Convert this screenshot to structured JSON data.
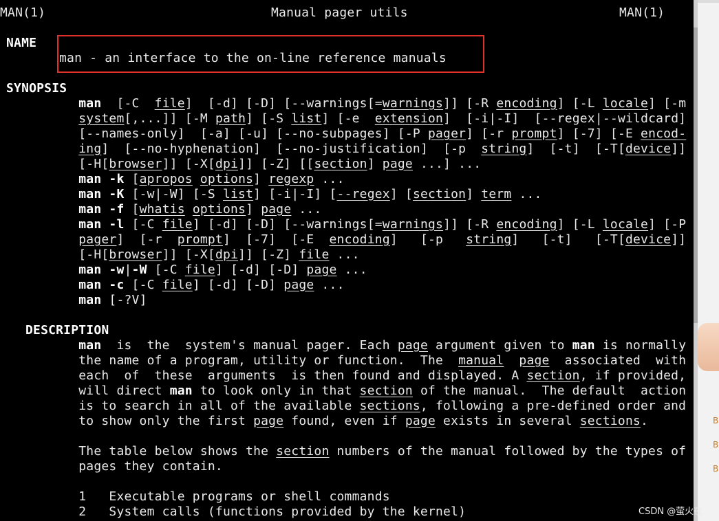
{
  "header": {
    "left": "MAN(1)",
    "center": "Manual pager utils",
    "right": "MAN(1)"
  },
  "name_section": {
    "heading": "NAME",
    "text": "man - an interface to the on-line reference manuals"
  },
  "synopsis_heading": "SYNOPSIS",
  "description_heading": "DESCRIPTION",
  "lines": [
    [
      {
        "t": "       "
      },
      {
        "t": "man",
        "b": 1
      },
      {
        "t": "  [-C  "
      },
      {
        "t": "file",
        "u": 1
      },
      {
        "t": "]  [-d] [-D] [--warnings[="
      },
      {
        "t": "warnings",
        "u": 1
      },
      {
        "t": "]] [-R "
      },
      {
        "t": "encoding",
        "u": 1
      },
      {
        "t": "] [-L "
      },
      {
        "t": "locale",
        "u": 1
      },
      {
        "t": "] [-m"
      }
    ],
    [
      {
        "t": "       "
      },
      {
        "t": "system",
        "u": 1
      },
      {
        "t": "[,...]] [-M "
      },
      {
        "t": "path",
        "u": 1
      },
      {
        "t": "] [-S "
      },
      {
        "t": "list",
        "u": 1
      },
      {
        "t": "] [-e  "
      },
      {
        "t": "extension",
        "u": 1
      },
      {
        "t": "]  [-i|-I]  [--regex|--wildcard]"
      }
    ],
    [
      {
        "t": "       [--names-only]  [-a] [-u] [--no-subpages] [-P "
      },
      {
        "t": "pager",
        "u": 1
      },
      {
        "t": "] [-r "
      },
      {
        "t": "prompt",
        "u": 1
      },
      {
        "t": "] [-7] [-E "
      },
      {
        "t": "encod-",
        "u": 1
      }
    ],
    [
      {
        "t": "       "
      },
      {
        "t": "ing",
        "u": 1
      },
      {
        "t": "]  [--no-hyphenation]  [--no-justification]  [-p  "
      },
      {
        "t": "string",
        "u": 1
      },
      {
        "t": "]  [-t]  [-T["
      },
      {
        "t": "device",
        "u": 1
      },
      {
        "t": "]]"
      }
    ],
    [
      {
        "t": "       [-H["
      },
      {
        "t": "browser",
        "u": 1
      },
      {
        "t": "]] [-X["
      },
      {
        "t": "dpi",
        "u": 1
      },
      {
        "t": "]] [-Z] [["
      },
      {
        "t": "section",
        "u": 1
      },
      {
        "t": "] "
      },
      {
        "t": "page",
        "u": 1
      },
      {
        "t": " ...] ..."
      }
    ],
    [
      {
        "t": "       "
      },
      {
        "t": "man -k",
        "b": 1
      },
      {
        "t": " ["
      },
      {
        "t": "apropos",
        "u": 1
      },
      {
        "t": " "
      },
      {
        "t": "options",
        "u": 1
      },
      {
        "t": "] "
      },
      {
        "t": "regexp",
        "u": 1
      },
      {
        "t": " ..."
      }
    ],
    [
      {
        "t": "       "
      },
      {
        "t": "man -K",
        "b": 1
      },
      {
        "t": " [-w|-W] [-S "
      },
      {
        "t": "list",
        "u": 1
      },
      {
        "t": "] [-i|-I] ["
      },
      {
        "t": "--regex",
        "u": 1
      },
      {
        "t": "] ["
      },
      {
        "t": "section",
        "u": 1
      },
      {
        "t": "] "
      },
      {
        "t": "term",
        "u": 1
      },
      {
        "t": " ..."
      }
    ],
    [
      {
        "t": "       "
      },
      {
        "t": "man -f",
        "b": 1
      },
      {
        "t": " ["
      },
      {
        "t": "whatis",
        "u": 1
      },
      {
        "t": " "
      },
      {
        "t": "options",
        "u": 1
      },
      {
        "t": "] "
      },
      {
        "t": "page",
        "u": 1
      },
      {
        "t": " ..."
      }
    ],
    [
      {
        "t": "       "
      },
      {
        "t": "man -l",
        "b": 1
      },
      {
        "t": " [-C "
      },
      {
        "t": "file",
        "u": 1
      },
      {
        "t": "] [-d] [-D] [--warnings[="
      },
      {
        "t": "warnings",
        "u": 1
      },
      {
        "t": "]] [-R "
      },
      {
        "t": "encoding",
        "u": 1
      },
      {
        "t": "] [-L "
      },
      {
        "t": "locale",
        "u": 1
      },
      {
        "t": "] [-P"
      }
    ],
    [
      {
        "t": "       "
      },
      {
        "t": "pager",
        "u": 1
      },
      {
        "t": "]  [-r  "
      },
      {
        "t": "prompt",
        "u": 1
      },
      {
        "t": "]  [-7]  [-E  "
      },
      {
        "t": "encoding",
        "u": 1
      },
      {
        "t": "]   [-p   "
      },
      {
        "t": "string",
        "u": 1
      },
      {
        "t": "]   [-t]   [-T["
      },
      {
        "t": "device",
        "u": 1
      },
      {
        "t": "]]"
      }
    ],
    [
      {
        "t": "       [-H["
      },
      {
        "t": "browser",
        "u": 1
      },
      {
        "t": "]] [-X["
      },
      {
        "t": "dpi",
        "u": 1
      },
      {
        "t": "]] [-Z] "
      },
      {
        "t": "file",
        "u": 1
      },
      {
        "t": " ..."
      }
    ],
    [
      {
        "t": "       "
      },
      {
        "t": "man -w",
        "b": 1
      },
      {
        "t": "|"
      },
      {
        "t": "-W",
        "b": 1
      },
      {
        "t": " [-C "
      },
      {
        "t": "file",
        "u": 1
      },
      {
        "t": "] [-d] [-D] "
      },
      {
        "t": "page",
        "u": 1
      },
      {
        "t": " ..."
      }
    ],
    [
      {
        "t": "       "
      },
      {
        "t": "man -c",
        "b": 1
      },
      {
        "t": " [-C "
      },
      {
        "t": "file",
        "u": 1
      },
      {
        "t": "] [-d] [-D] "
      },
      {
        "t": "page",
        "u": 1
      },
      {
        "t": " ..."
      }
    ],
    [
      {
        "t": "       "
      },
      {
        "t": "man",
        "b": 1
      },
      {
        "t": " [-?V]"
      }
    ],
    [],
    [
      {
        "t": "DESCRIPTION",
        "b": 1
      }
    ],
    [
      {
        "t": "       "
      },
      {
        "t": "man",
        "b": 1
      },
      {
        "t": "  is  the  system's manual pager. Each "
      },
      {
        "t": "page",
        "u": 1
      },
      {
        "t": " argument given to "
      },
      {
        "t": "man",
        "b": 1
      },
      {
        "t": " is normally"
      }
    ],
    [
      {
        "t": "       the name of a program, utility or function.  The  "
      },
      {
        "t": "manual",
        "u": 1
      },
      {
        "t": "  "
      },
      {
        "t": "page",
        "u": 1
      },
      {
        "t": "  associated  with"
      }
    ],
    [
      {
        "t": "       each  of  these  arguments  is then found and displayed. A "
      },
      {
        "t": "section",
        "u": 1
      },
      {
        "t": ", if provided,"
      }
    ],
    [
      {
        "t": "       will direct "
      },
      {
        "t": "man",
        "b": 1
      },
      {
        "t": " to look only in that "
      },
      {
        "t": "section",
        "u": 1
      },
      {
        "t": " of the manual.  The default  action"
      }
    ],
    [
      {
        "t": "       is to search in all of the available "
      },
      {
        "t": "sections",
        "u": 1
      },
      {
        "t": ", following a pre-defined order and"
      }
    ],
    [
      {
        "t": "       to show only the first "
      },
      {
        "t": "page",
        "u": 1
      },
      {
        "t": " found, even if "
      },
      {
        "t": "page",
        "u": 1
      },
      {
        "t": " exists in several "
      },
      {
        "t": "sections",
        "u": 1
      },
      {
        "t": "."
      }
    ],
    [],
    [
      {
        "t": "       The table below shows the "
      },
      {
        "t": "section",
        "u": 1
      },
      {
        "t": " numbers of the manual followed by the types of"
      }
    ],
    [
      {
        "t": "       pages they contain."
      }
    ],
    [],
    [
      {
        "t": "       1   Executable programs or shell commands"
      }
    ],
    [
      {
        "t": "       2   System calls (functions provided by the kernel)"
      }
    ]
  ],
  "watermark": "CSDN @萤火夜"
}
